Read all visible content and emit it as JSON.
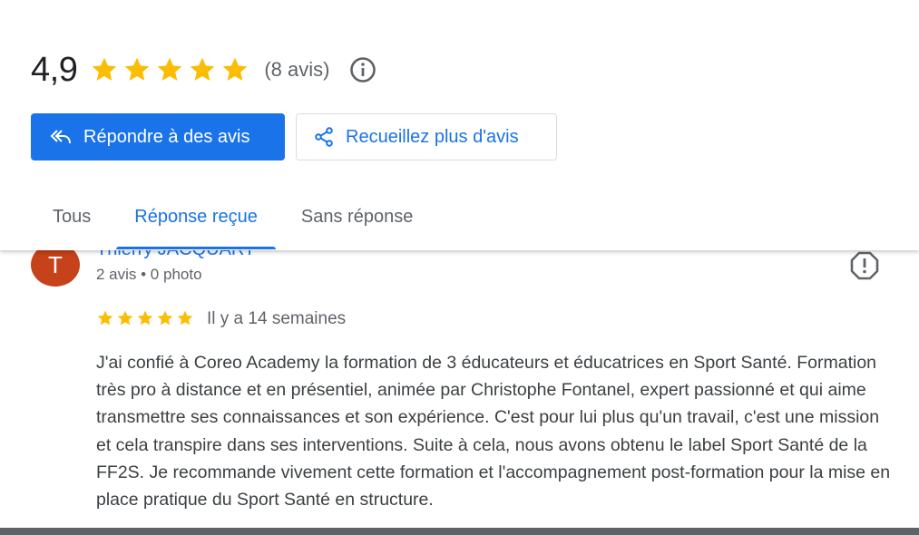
{
  "summary": {
    "score": "4,9",
    "stars": 5,
    "count": "(8 avis)"
  },
  "actions": {
    "reply": "Répondre à des avis",
    "collect": "Recueillez plus d'avis"
  },
  "tabs": [
    {
      "label": "Tous"
    },
    {
      "label": "Réponse reçue"
    },
    {
      "label": "Sans réponse"
    }
  ],
  "review": {
    "avatar_letter": "T",
    "author": "Thierry JACQUART",
    "meta": "2 avis • 0 photo",
    "stars": 5,
    "age": "Il y a 14 semaines",
    "text": "J'ai confié à Coreo Academy la formation de 3 éducateurs et éducatrices en Sport Santé. Formation très pro à distance et en présentiel, animée par Christophe Fontanel, expert passionné et qui aime transmettre ses connaissances et son expérience. C'est pour lui plus qu'un travail, c'est une mission et cela transpire dans ses interventions. Suite à cela, nous avons obtenu le label Sport Santé de la FF2S. Je recommande vivement cette formation et l'accompagnement post-formation pour la mise en place pratique du Sport Santé en structure."
  },
  "colors": {
    "accent": "#1a73e8",
    "star": "#fbbc04",
    "avatar": "#c5421a"
  }
}
